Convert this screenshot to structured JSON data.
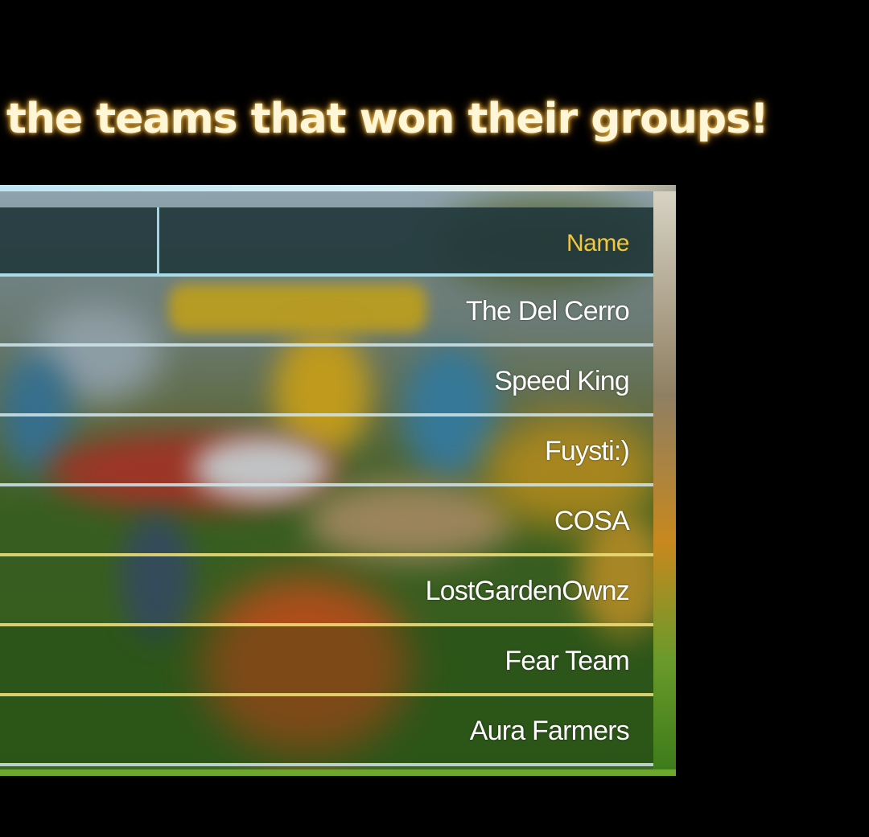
{
  "headline": "the teams that won their groups!",
  "table": {
    "header": "Name",
    "rows": [
      {
        "name": "The Del Cerro"
      },
      {
        "name": "Speed King"
      },
      {
        "name": "Fuysti:)"
      },
      {
        "name": "COSA"
      },
      {
        "name": "LostGardenOwnz"
      },
      {
        "name": "Fear Team"
      },
      {
        "name": "Aura Farmers"
      }
    ]
  },
  "colors": {
    "background": "#000000",
    "headline": "#fff6d8",
    "header_label": "#f2c73a",
    "row_text": "#ffffff",
    "header_bg": "#22383c"
  }
}
